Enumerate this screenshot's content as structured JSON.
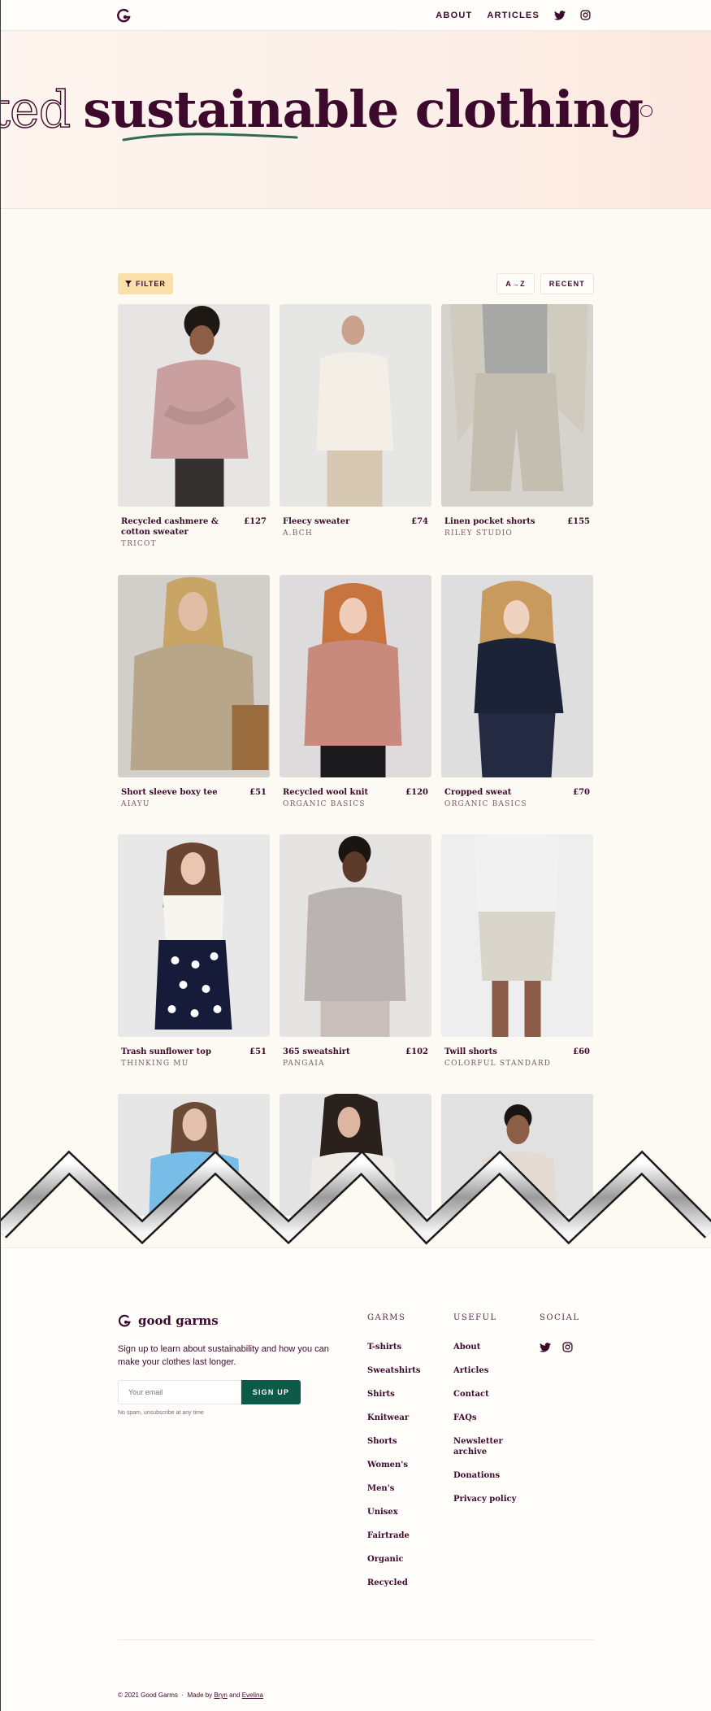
{
  "header": {
    "nav": [
      {
        "label": "ABOUT"
      },
      {
        "label": "ARTICLES"
      }
    ],
    "icons": [
      "logo-icon",
      "twitter-icon",
      "instagram-icon"
    ]
  },
  "hero": {
    "outline_text": "ted",
    "headline": "sustainable clothing"
  },
  "toolbar": {
    "filter_label": "FILTER",
    "sort_az_label": "A→Z",
    "sort_recent_label": "RECENT"
  },
  "products": [
    {
      "name": "Recycled cashmere & cotton sweater",
      "price": "£127",
      "brand": "TRICOT"
    },
    {
      "name": "Fleecy sweater",
      "price": "£74",
      "brand": "A.BCH"
    },
    {
      "name": "Linen pocket shorts",
      "price": "£155",
      "brand": "RILEY STUDIO"
    },
    {
      "name": "Short sleeve boxy tee",
      "price": "£51",
      "brand": "AIAYU"
    },
    {
      "name": "Recycled wool knit",
      "price": "£120",
      "brand": "ORGANIC BASICS"
    },
    {
      "name": "Cropped sweat",
      "price": "£70",
      "brand": "ORGANIC BASICS"
    },
    {
      "name": "Trash sunflower top",
      "price": "£51",
      "brand": "THINKING MU"
    },
    {
      "name": "365 sweatshirt",
      "price": "£102",
      "brand": "PANGAIA"
    },
    {
      "name": "Twill shorts",
      "price": "£60",
      "brand": "COLORFUL STANDARD"
    }
  ],
  "footer": {
    "brand": "good garms",
    "blurb": "Sign up to learn about sustainability and how you can make your clothes last longer.",
    "email_placeholder": "Your email",
    "signup_label": "SIGN UP",
    "note": "No spam, unsubscribe at any time",
    "garms_heading": "GARMS",
    "garms_links": [
      "T-shirts",
      "Sweatshirts",
      "Shirts",
      "Knitwear",
      "Shorts",
      "Women's",
      "Men's",
      "Unisex",
      "Fairtrade",
      "Organic",
      "Recycled"
    ],
    "useful_heading": "USEFUL",
    "useful_links": [
      "About",
      "Articles",
      "Contact",
      "FAQs",
      "Newsletter archive",
      "Donations",
      "Privacy policy"
    ],
    "social_heading": "SOCIAL",
    "copyright": "© 2021 Good Garms",
    "made_by": "Made by",
    "author1": "Bryn",
    "and": "and",
    "author2": "Evelina"
  },
  "colors": {
    "plum": "#3d0a2e",
    "green": "#0d5a48",
    "filter_bg": "#f9e0a8",
    "page_bg": "#fdf9f3"
  }
}
